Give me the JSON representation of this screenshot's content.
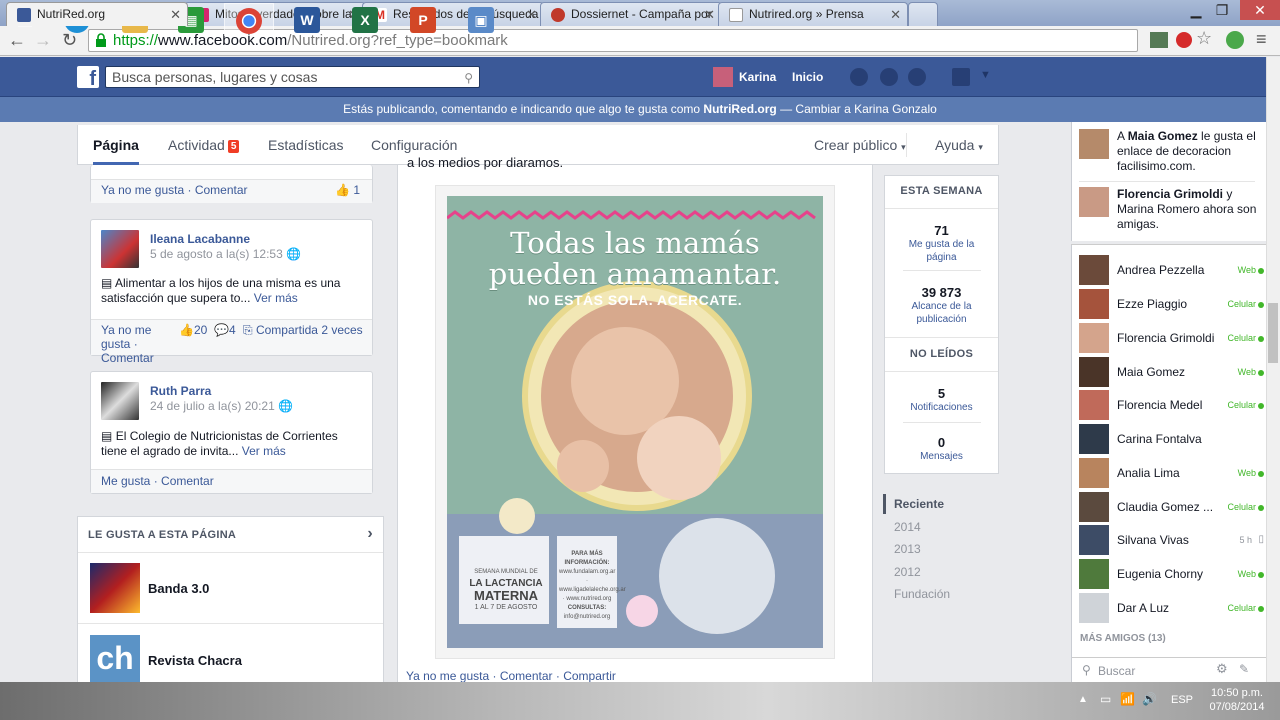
{
  "browser": {
    "tabs": [
      {
        "title": "NutriRed.org",
        "favicon_color": "#3b5998"
      },
      {
        "title": "Mitos y verdades sobre la",
        "favicon_color": "#d6246e"
      },
      {
        "title": "Resultados de la búsqueda",
        "favicon_color": "#d93025"
      },
      {
        "title": "Dossiernet - Campaña por",
        "favicon_color": "#c0392b"
      },
      {
        "title": "Nutrired.org » Prensa",
        "favicon_color": "#ffffff"
      }
    ],
    "url_scheme": "https://",
    "url_host": "www.facebook.com",
    "url_rest": "/Nutrired.org?ref_type=bookmark"
  },
  "fb": {
    "search_placeholder": "Busca personas, lugares y cosas",
    "user_name": "Karina",
    "home_label": "Inicio",
    "acting_prefix": "Estás publicando, comentando e indicando que algo te gusta como ",
    "acting_page": "NutriRed.org",
    "acting_switch": " — Cambiar a Karina Gonzalo"
  },
  "pagenav": {
    "pagina": "Página",
    "actividad": "Actividad",
    "actividad_count": "5",
    "estadisticas": "Estadísticas",
    "configuracion": "Configuración",
    "crear_publico": "Crear público",
    "ayuda": "Ayuda"
  },
  "top_card": {
    "unlike": "Ya no me gusta",
    "comment": "Comentar",
    "likes": "1"
  },
  "posts": [
    {
      "name": "Ileana Lacabanne",
      "date": "5 de agosto a la(s) 12:53",
      "text": "Alimentar a los hijos de una misma es una satisfacción que supera to...",
      "more": "Ver más",
      "action1": "Ya no me gusta",
      "action2": "Comentar",
      "likes": "20",
      "comments": "4",
      "shares": "Compartida 2 veces"
    },
    {
      "name": "Ruth Parra",
      "date": "24 de julio a la(s) 20:21",
      "text": "El Colegio de Nutricionistas de Corrientes tiene el agrado de invita...",
      "more": "Ver más",
      "action1": "Me gusta",
      "action2": "Comentar"
    }
  ],
  "likes_box": {
    "header": "LE GUSTA A ESTA PÁGINA",
    "pages": [
      {
        "name": "Banda 3.0"
      },
      {
        "name": "Revista Chacra",
        "logo_text": "ch"
      }
    ]
  },
  "center_post": {
    "top_text": "a los medios por diaramos.",
    "poster_line1": "Todas las mamás",
    "poster_line2": "pueden amamantar.",
    "poster_line3": "NO ESTÁS SOLA. ACERCATE.",
    "poster_semana": "SEMANA MUNDIAL DE",
    "poster_lactancia": "LA LACTANCIA",
    "poster_materna": "MATERNA",
    "poster_fechas": "1 AL 7 DE AGOSTO",
    "poster_info_title": "PARA MÁS INFORMACIÓN:",
    "poster_info_sites": "www.fundalam.org.ar · www.ligadelaleche.org.ar · www.nutrired.org",
    "poster_consultas": "CONSULTAS:",
    "poster_email": "info@nutrired.org",
    "footer_unlike": "Ya no me gusta",
    "footer_comment": "Comentar",
    "footer_share": "Compartir"
  },
  "stats": {
    "week_header": "ESTA SEMANA",
    "likes_num": "71",
    "likes_label": "Me gusta de la página",
    "reach_num": "39 873",
    "reach_label": "Alcance de la publicación",
    "unread_header": "NO LEÍDOS",
    "notif_num": "5",
    "notif_label": "Notificaciones",
    "msg_num": "0",
    "msg_label": "Mensajes"
  },
  "timeline": [
    "Reciente",
    "2014",
    "2013",
    "2012",
    "Fundación"
  ],
  "ticker": [
    {
      "pre": "A ",
      "bold": "Maia Gomez",
      "post": " le gusta el enlace de decoracion facilisimo.com."
    },
    {
      "pre": "",
      "bold": "Florencia Grimoldi",
      "post": " y Marina Romero ahora son amigas."
    }
  ],
  "chat": {
    "friends": [
      {
        "name": "Andrea Pezzella",
        "status": "Web"
      },
      {
        "name": "Ezze Piaggio",
        "status": "Celular"
      },
      {
        "name": "Florencia Grimoldi",
        "status": "Celular"
      },
      {
        "name": "Maia Gomez",
        "status": "Web"
      },
      {
        "name": "Florencia Medel",
        "status": "Celular"
      },
      {
        "name": "Carina Fontalva",
        "status": ""
      },
      {
        "name": "Analia Lima",
        "status": "Web"
      },
      {
        "name": "Claudia Gomez ...",
        "status": "Celular"
      },
      {
        "name": "Silvana Vivas",
        "status": "5 h"
      },
      {
        "name": "Eugenia Chorny",
        "status": "Web"
      },
      {
        "name": "Dar A Luz",
        "status": "Celular"
      }
    ],
    "more_friends": "MÁS AMIGOS (13)",
    "search_placeholder": "Buscar"
  },
  "system": {
    "lang": "ESP",
    "time": "10:50 p.m.",
    "date": "07/08/2014"
  }
}
